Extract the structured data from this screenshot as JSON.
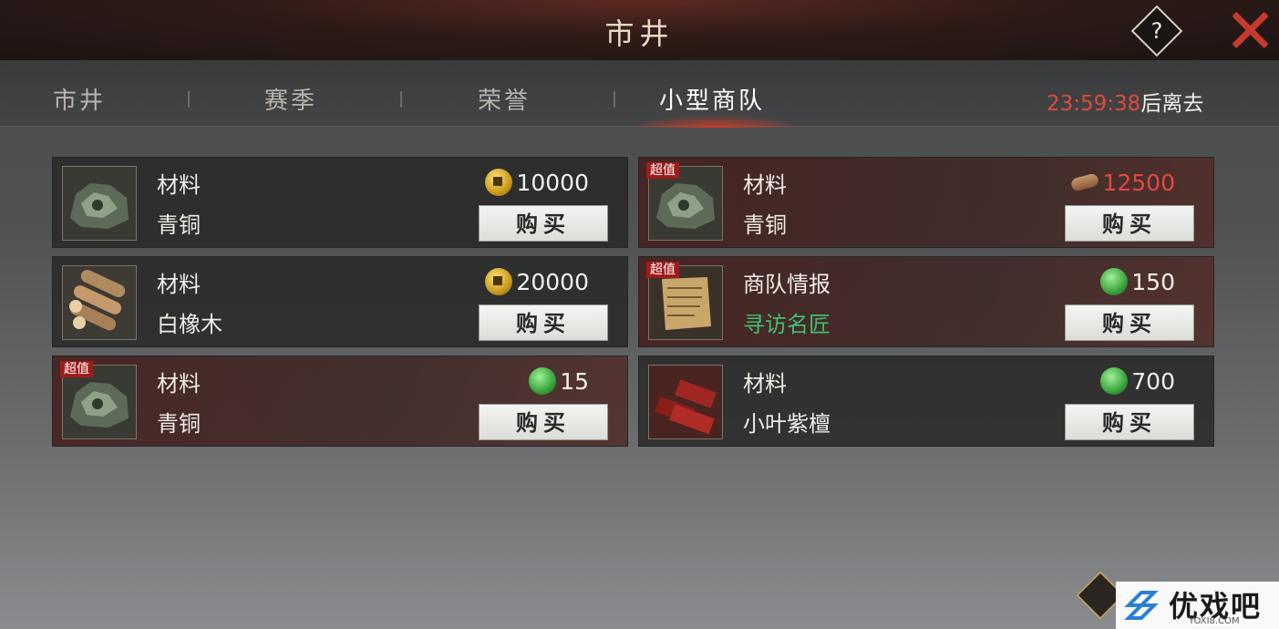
{
  "header": {
    "title": "市井",
    "help_icon": "?",
    "close_icon": "close-icon"
  },
  "tabs": [
    {
      "label": "市井",
      "active": false
    },
    {
      "label": "赛季",
      "active": false
    },
    {
      "label": "荣誉",
      "active": false
    },
    {
      "label": "小型商队",
      "active": true
    }
  ],
  "timer": {
    "time": "23:59:38",
    "suffix": "后离去"
  },
  "items": [
    {
      "badge": "",
      "category": "材料",
      "name": "青铜",
      "currency": "copper-coin-icon",
      "price": "10000",
      "buy": "购买"
    },
    {
      "badge": "超值",
      "category": "材料",
      "name": "青铜",
      "currency": "wood-log-icon",
      "price": "12500",
      "buy": "购买"
    },
    {
      "badge": "",
      "category": "材料",
      "name": "白橡木",
      "currency": "copper-coin-icon",
      "price": "20000",
      "buy": "购买"
    },
    {
      "badge": "超值",
      "category": "商队情报",
      "name": "寻访名匠",
      "currency": "jade-icon",
      "price": "150",
      "buy": "购买"
    },
    {
      "badge": "超值",
      "category": "材料",
      "name": "青铜",
      "currency": "jade-icon",
      "price": "15",
      "buy": "购买"
    },
    {
      "badge": "",
      "category": "材料",
      "name": "小叶紫檀",
      "currency": "jade-icon",
      "price": "700",
      "buy": "购买"
    }
  ],
  "watermark": {
    "text": "优戏吧",
    "sub": "YOXI8.COM"
  }
}
